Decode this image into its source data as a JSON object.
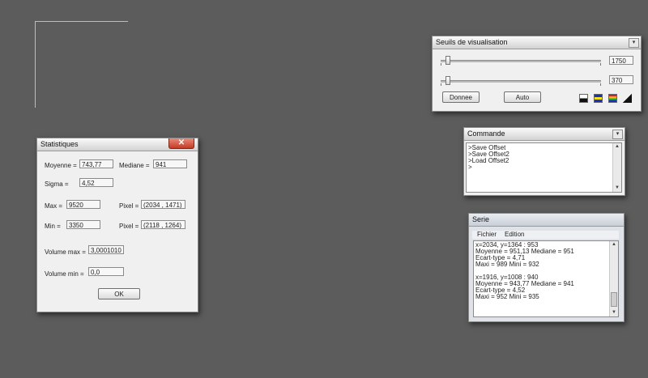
{
  "stats_window": {
    "title": "Statistiques",
    "close_glyph": "✕",
    "moyenne_label": "Moyenne =",
    "moyenne_value": "743,77",
    "mediane_label": "Mediane =",
    "mediane_value": "941",
    "sigma_label": "Sigma =",
    "sigma_value": "4,52",
    "max_label": "Max =",
    "max_value": "9520",
    "pixel_max_label": "Pixel =",
    "pixel_max_value": "(2034 , 1471)",
    "min_label": "Min =",
    "min_value": "3350",
    "pixel_min_label": "Pixel =",
    "pixel_min_value": "(2118 , 1264)",
    "volume_max_label": "Volume max =",
    "volume_max_value": "3,0001010",
    "volume_min_label": "Volume min =",
    "volume_min_value": "0,0",
    "ok_label": "OK"
  },
  "seuils_window": {
    "title": "Seuils de visualisation",
    "collapse_glyph": "▾",
    "slider_high_value": "1750",
    "slider_low_value": "370",
    "slider_high_level": 0.03,
    "slider_low_level": 0.03,
    "donnee_label": "Donnee",
    "auto_label": "Auto"
  },
  "commande_window": {
    "title": "Commande",
    "collapse_glyph": "▾",
    "lines": [
      ">Save Offset",
      ">Save Offset2",
      ">Load Offset2",
      ">"
    ]
  },
  "serie_window": {
    "title": "Serie",
    "menu_fichier": "Fichier",
    "menu_edition": "Edition",
    "lines": [
      "x=2034, y=1364 : 953",
      "Moyenne = 951,13  Mediane = 951",
      "Ecart-type = 4,71",
      "Maxi = 989  Mini = 932",
      "",
      "x=1916, y=1008 : 940",
      "Moyenne = 943,77  Mediane = 941",
      "Ecart-type = 4,52",
      "Maxi = 952  Mini = 935"
    ]
  },
  "colors": {
    "desktop": "#5c5c5c",
    "window_bg": "#f0f0f0",
    "close_red": "#c43b25"
  }
}
